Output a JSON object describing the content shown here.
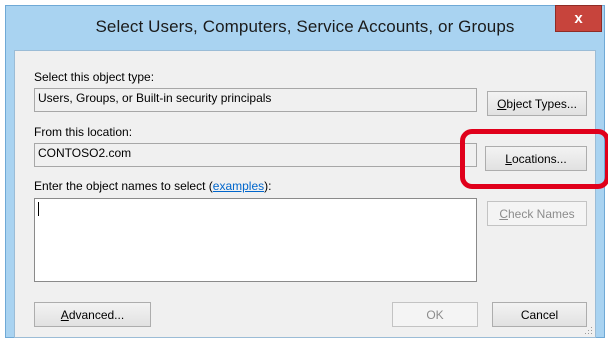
{
  "window": {
    "title": "Select Users, Computers, Service Accounts, or Groups",
    "close_glyph": "x"
  },
  "object_type": {
    "label": "Select this object type:",
    "value": "Users, Groups, or Built-in security principals",
    "button": "Object Types..."
  },
  "location": {
    "label": "From this location:",
    "value": "CONTOSO2.com",
    "button": "Locations..."
  },
  "names": {
    "label_prefix": "Enter the object names to select (",
    "link": "examples",
    "label_suffix": "):",
    "value": "",
    "check_button": "Check Names"
  },
  "footer": {
    "advanced": "Advanced...",
    "ok": "OK",
    "cancel": "Cancel"
  },
  "colors": {
    "highlight": "#e0001b",
    "link": "#0066cc",
    "close": "#c7443c",
    "window_frame": "#a9d3f1"
  }
}
